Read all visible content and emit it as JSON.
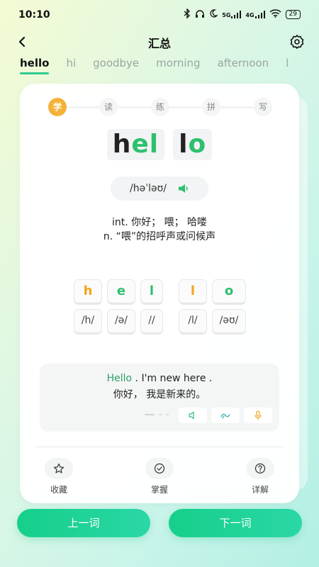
{
  "status_bar": {
    "time": "10:10",
    "network": "5G",
    "network2": "4G",
    "battery": "29"
  },
  "nav": {
    "title": "汇总"
  },
  "word_tabs": [
    "hello",
    "hi",
    "goodbye",
    "morning",
    "afternoon",
    "l"
  ],
  "steps": [
    "学",
    "读",
    "练",
    "拼",
    "写"
  ],
  "word": {
    "chunks": [
      {
        "parts": [
          {
            "text": "h",
            "color": "#222222"
          },
          {
            "text": "el",
            "color": "#2ec06f"
          }
        ]
      },
      {
        "parts": [
          {
            "text": "l",
            "color": "#222222"
          },
          {
            "text": "o",
            "color": "#2ec06f"
          }
        ]
      }
    ],
    "phonetic": "/həˈləʊ/"
  },
  "definitions": [
    "int. 你好； 喂； 哈喽",
    "n. “喂”的招呼声或问候声"
  ],
  "tiles": {
    "letters": [
      "h",
      "e",
      "l",
      "l",
      "o"
    ],
    "phonemes": [
      "/h/",
      "/ə/",
      "//",
      "/l/",
      "/əʊ/"
    ]
  },
  "example": {
    "highlight": "Hello",
    "rest": " . I'm new here .",
    "translation": "你好， 我是新来的。"
  },
  "actions": [
    {
      "label": "收藏"
    },
    {
      "label": "掌握"
    },
    {
      "label": "详解"
    }
  ],
  "buttons": {
    "prev": "上一词",
    "next": "下一词"
  },
  "colors": {
    "accent_green": "#2ec06f",
    "accent_orange": "#f2a41c",
    "button_gradient_start": "#16cf8a",
    "button_gradient_end": "#2ad7a6"
  }
}
